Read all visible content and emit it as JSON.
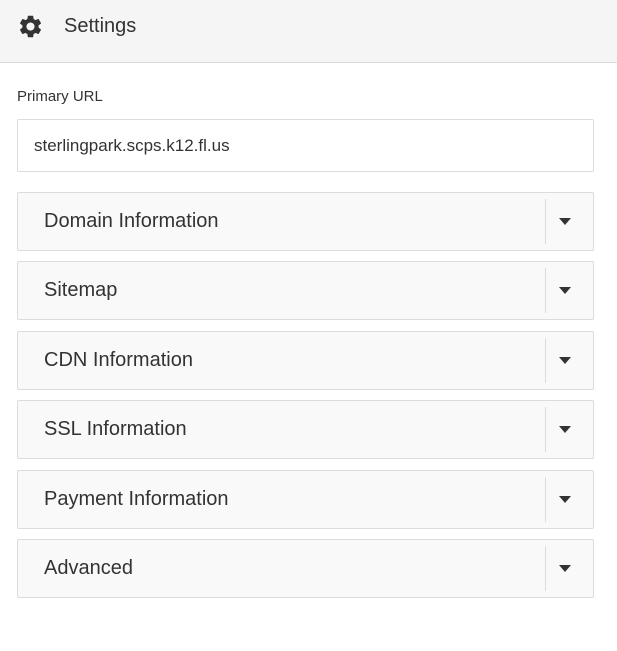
{
  "header": {
    "icon": "gear-icon",
    "title": "Settings",
    "background": "#f5f5f5"
  },
  "primary_url": {
    "label": "Primary URL",
    "value": "sterlingpark.scps.k12.fl.us"
  },
  "sections": [
    {
      "label": "Domain Information",
      "icon": "chevron-down-icon"
    },
    {
      "label": "Sitemap",
      "icon": "chevron-down-icon"
    },
    {
      "label": "CDN Information",
      "icon": "chevron-down-icon"
    },
    {
      "label": "SSL Information",
      "icon": "chevron-down-icon"
    },
    {
      "label": "Payment Information",
      "icon": "chevron-down-icon"
    },
    {
      "label": "Advanced",
      "icon": "chevron-down-icon"
    }
  ],
  "colors": {
    "text": "#333333",
    "border": "#dcdcdc",
    "section_background": "#f9f9f9"
  }
}
